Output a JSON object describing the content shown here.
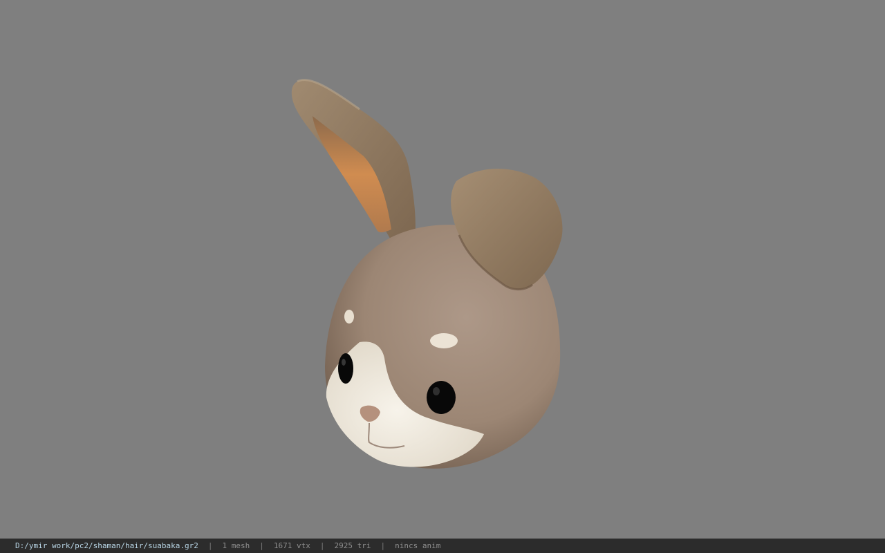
{
  "viewport": {
    "background": "#7f7f7f",
    "model_icon": "bunny-head-model"
  },
  "status_bar": {
    "file_path": "D:/ymir work/pc2/shaman/hair/suabaka.gr2",
    "separator": "|",
    "mesh_count": "1 mesh",
    "vertex_count": "1671 vtx",
    "triangle_count": "2925 tri",
    "anim_info": "nincs anim"
  },
  "colors": {
    "fur": "#a58f7e",
    "fur_dark": "#7a6656",
    "ear": "#8f7a62",
    "inner_ear": "#c98d55",
    "muzzle": "#f0ebe0",
    "nose": "#b89682",
    "eye": "#0a0a0a",
    "status_bg": "#2c2c2c",
    "path_text": "#b9d6e6"
  }
}
